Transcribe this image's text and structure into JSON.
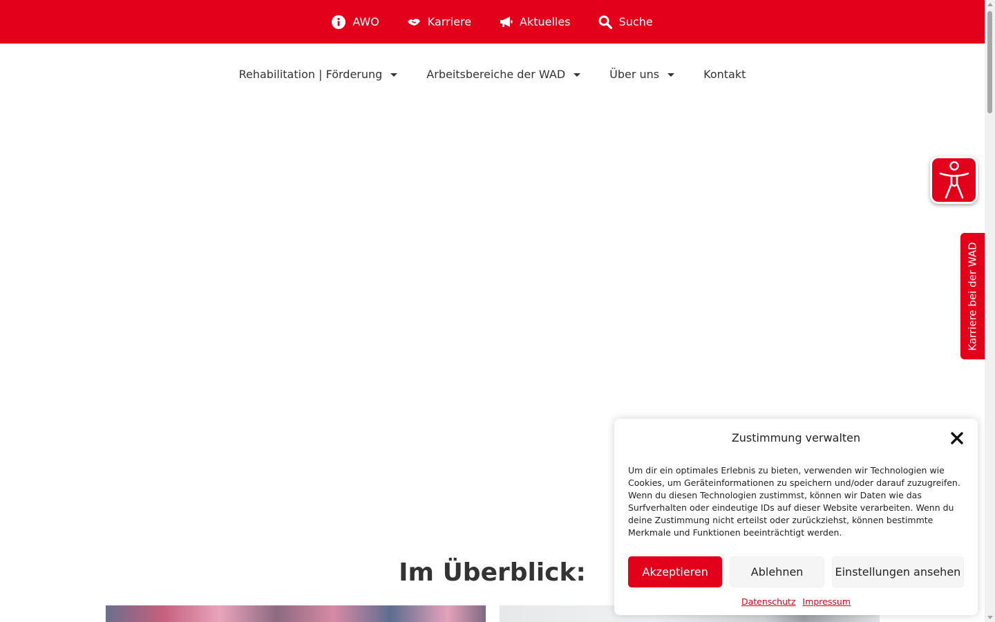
{
  "topbar": {
    "items": [
      {
        "label": "AWO",
        "icon": "info-circle-icon"
      },
      {
        "label": "Karriere",
        "icon": "handshake-icon"
      },
      {
        "label": "Aktuelles",
        "icon": "megaphone-icon"
      },
      {
        "label": "Suche",
        "icon": "search-icon"
      }
    ]
  },
  "mainnav": {
    "items": [
      {
        "label": "Rehabilitation | Förderung",
        "has_dropdown": true
      },
      {
        "label": "Arbeitsbereiche der WAD",
        "has_dropdown": true
      },
      {
        "label": "Über uns",
        "has_dropdown": true
      },
      {
        "label": "Kontakt",
        "has_dropdown": false
      }
    ]
  },
  "side": {
    "accessibility_icon": "accessibility-person-icon",
    "career_tab_label": "Karriere bei der WAD"
  },
  "content": {
    "section_heading": "Im Überblick:"
  },
  "consent": {
    "title": "Zustimmung verwalten",
    "text": "Um dir ein optimales Erlebnis zu bieten, verwenden wir Technologien wie Cookies, um Geräteinformationen zu speichern und/oder darauf zuzugreifen. Wenn du diesen Technologien zustimmst, können wir Daten wie das Surfverhalten oder eindeutige IDs auf dieser Website verarbeiten. Wenn du deine Zustimmung nicht erteilst oder zurückziehst, können bestimmte Merkmale und Funktionen beeinträchtigt werden.",
    "accept_label": "Akzeptieren",
    "deny_label": "Ablehnen",
    "settings_label": "Einstellungen ansehen",
    "privacy_link": "Datenschutz",
    "imprint_link": "Impressum"
  },
  "colors": {
    "brand_red": "#e2001a",
    "text": "#333333"
  }
}
